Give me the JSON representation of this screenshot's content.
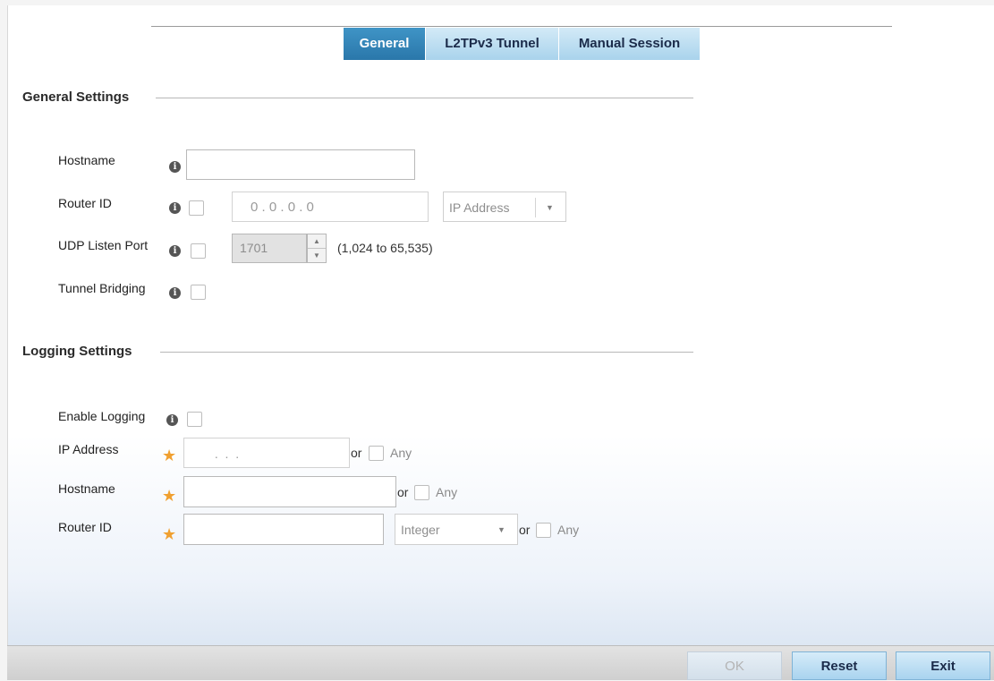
{
  "tabs": {
    "general": "General",
    "l2tpv3_tunnel": "L2TPv3 Tunnel",
    "manual_session": "Manual Session",
    "active": "General"
  },
  "general_settings": {
    "title": "General Settings",
    "hostname": {
      "label": "Hostname",
      "value": ""
    },
    "router_id": {
      "label": "Router ID",
      "ip_placeholder": "0 . 0 . 0 . 0",
      "type_value": "IP Address"
    },
    "udp_listen_port": {
      "label": "UDP Listen Port",
      "value": "1701",
      "range": "(1,024 to 65,535)"
    },
    "tunnel_bridging": {
      "label": "Tunnel Bridging"
    }
  },
  "logging_settings": {
    "title": "Logging Settings",
    "enable_logging": {
      "label": "Enable Logging"
    },
    "ip_address": {
      "label": "IP Address",
      "placeholder": " .  .  . ",
      "or": "or",
      "any": "Any"
    },
    "hostname": {
      "label": "Hostname",
      "value": "",
      "or": "or",
      "any": "Any"
    },
    "router_id": {
      "label": "Router ID",
      "value": "",
      "type_value": "Integer",
      "or": "or",
      "any": "Any"
    }
  },
  "footer": {
    "ok": "OK",
    "reset": "Reset",
    "exit": "Exit"
  },
  "icons": {
    "info": "i",
    "required": "★",
    "dropdown_arrow": "▼",
    "spin_up": "▲",
    "spin_down": "▼"
  },
  "colors": {
    "active_tab": "#2a77aa",
    "inactive_tab": "#a9d3ec",
    "required_star": "#f0a030"
  }
}
